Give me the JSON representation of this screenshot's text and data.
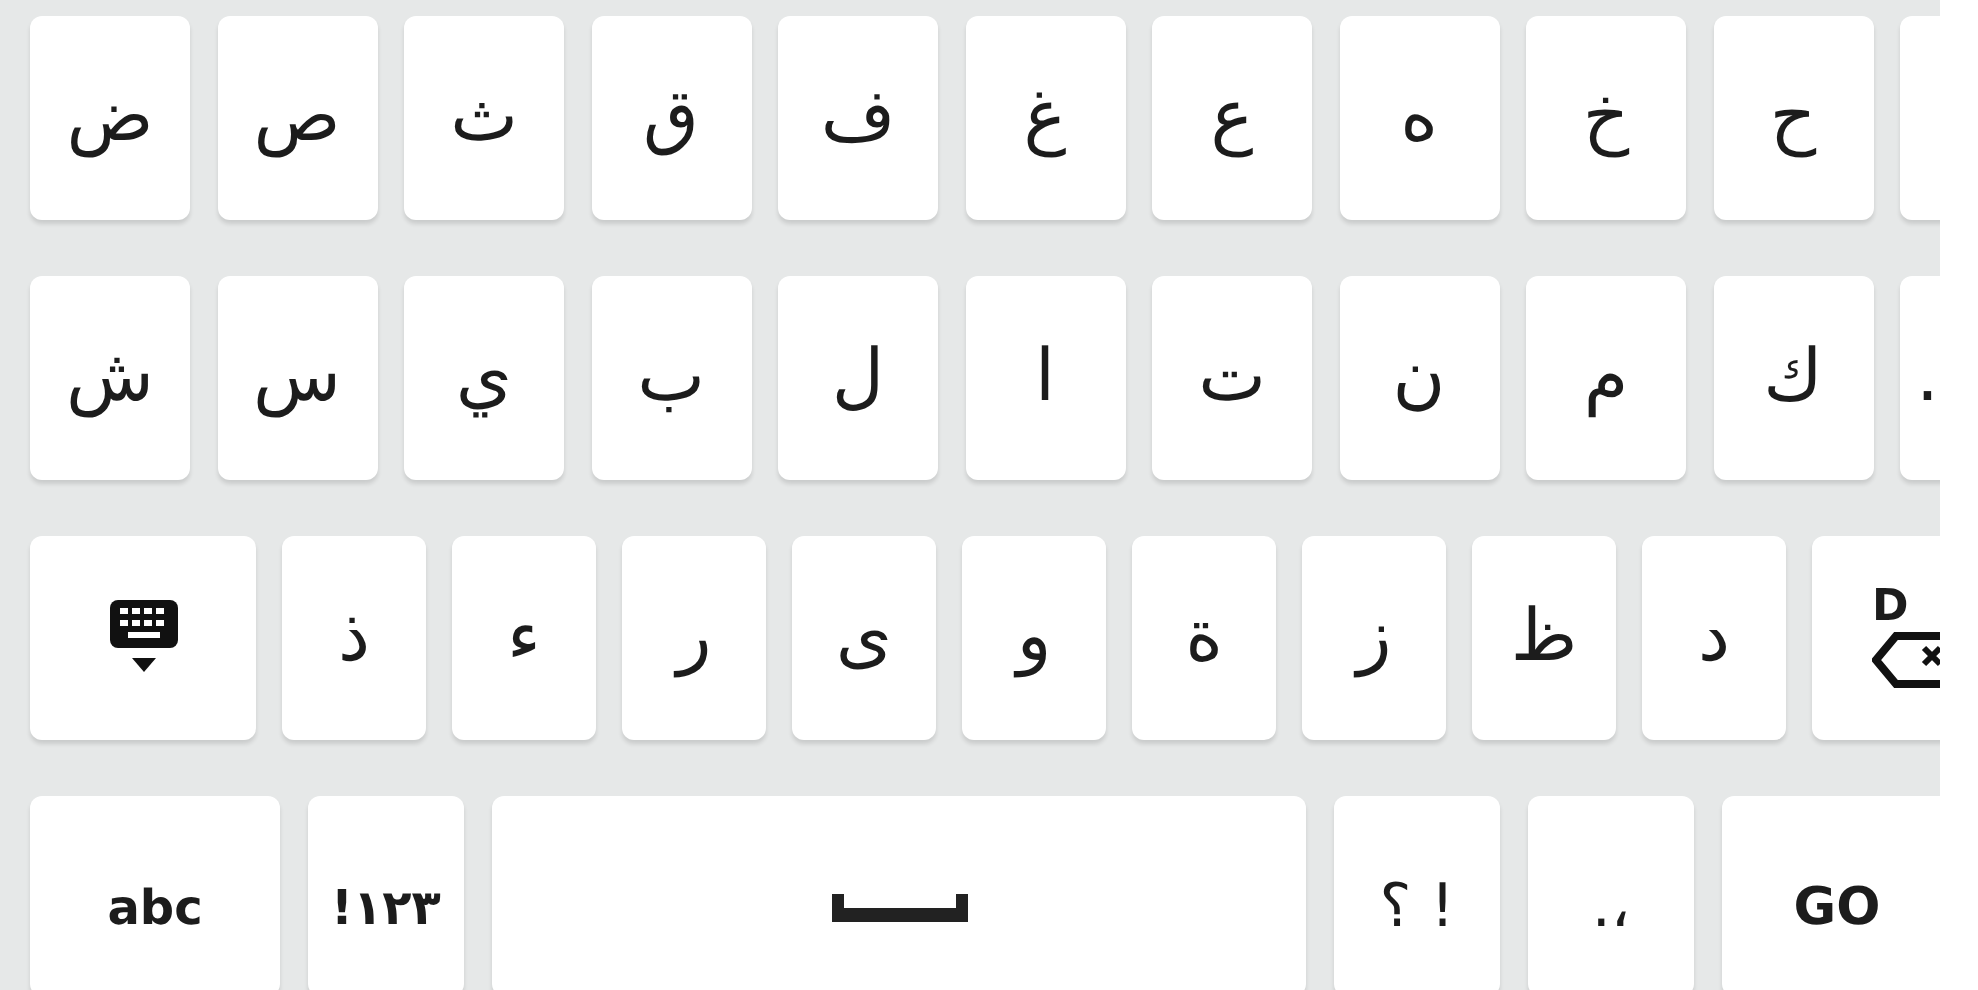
{
  "keyboard": {
    "rows": [
      {
        "keys": [
          {
            "kind": "blank"
          },
          {
            "kind": "char",
            "label": "ح"
          },
          {
            "kind": "char",
            "label": "خ"
          },
          {
            "kind": "char",
            "label": "ه"
          },
          {
            "kind": "char",
            "label": "ع"
          },
          {
            "kind": "char",
            "label": "غ"
          },
          {
            "kind": "char",
            "label": "ف"
          },
          {
            "kind": "char",
            "label": "ق"
          },
          {
            "kind": "char",
            "label": "ث"
          },
          {
            "kind": "char",
            "label": "ص"
          },
          {
            "kind": "char",
            "label": "ض"
          }
        ]
      },
      {
        "keys": [
          {
            "kind": "char",
            "label": "."
          },
          {
            "kind": "char",
            "label": "ك"
          },
          {
            "kind": "char",
            "label": "م"
          },
          {
            "kind": "char",
            "label": "ن"
          },
          {
            "kind": "char",
            "label": "ت"
          },
          {
            "kind": "char",
            "label": "ا"
          },
          {
            "kind": "char",
            "label": "ل"
          },
          {
            "kind": "char",
            "label": "ب"
          },
          {
            "kind": "char",
            "label": "ي"
          },
          {
            "kind": "char",
            "label": "س"
          },
          {
            "kind": "char",
            "label": "ش"
          }
        ]
      },
      {
        "keys": [
          {
            "kind": "delete",
            "label": "D"
          },
          {
            "kind": "char",
            "label": "د"
          },
          {
            "kind": "char",
            "label": "ظ"
          },
          {
            "kind": "char",
            "label": "ز"
          },
          {
            "kind": "char",
            "label": "ة"
          },
          {
            "kind": "char",
            "label": "و"
          },
          {
            "kind": "char",
            "label": "ى"
          },
          {
            "kind": "char",
            "label": "ر"
          },
          {
            "kind": "char",
            "label": "ء"
          },
          {
            "kind": "char",
            "label": "ذ"
          },
          {
            "kind": "hide"
          }
        ]
      },
      {
        "keys": [
          {
            "kind": "action",
            "label": "GO"
          },
          {
            "kind": "punct",
            "label": ".،"
          },
          {
            "kind": "punct",
            "label": "؟ !"
          },
          {
            "kind": "space"
          },
          {
            "kind": "mode",
            "label": "!١٢٣"
          },
          {
            "kind": "mode",
            "label": "abc"
          }
        ]
      }
    ]
  }
}
